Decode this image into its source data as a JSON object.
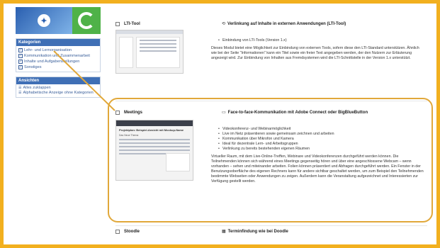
{
  "sidebar": {
    "kategorien": {
      "heading": "Kategorien",
      "items": [
        "Lehr- und Lernorganisation",
        "Kommunikation und Zusammenarbeit",
        "Inhalte und Aufgabenstellungen",
        "Sonstiges"
      ]
    },
    "ansichten": {
      "heading": "Ansichten",
      "items": [
        "Alles zuklappen",
        "Alphabetische Anzeige ohne Kategorien"
      ]
    }
  },
  "entries": [
    {
      "title": "LTI-Tool",
      "category": "Verlinkung auf Inhalte in externen Anwendungen (LTI-Tool)",
      "bullets": [
        "Einbindung von LTI-Tools (Version 1.x)"
      ],
      "paragraph": "Dieses Modul bietet eine Möglichkeit zur Einbindung von externen Tools, sofern diese den LTI-Standard unterstützen. Ähnlich wie bei der Seite \"Informationen\" kann ein Titel sowie ein freier Text angegeben werden, der den Nutzern zur Erläuterung angezeigt wird. Zur Einbindung von Inhalten aus Fremdsystemen wird die LTI-Schnittstelle in der Version 1.x unterstützt."
    },
    {
      "title": "Meetings",
      "category": "Face-to-face-Kommunikation mit Adobe Connect oder BigBlueButton",
      "bullets": [
        "Videokonferenz- und Webinarmöglichkeit",
        "Live im Netz präsentieren sowie gemeinsam zeichnen und arbeiten",
        "Kommunikation über Mikrofon und Kamera",
        "Ideal für dezentrale Lern- und Arbeitsgruppen",
        "Verlinkung zu bereits bestehenden eigenen Räumen"
      ],
      "paragraph": "Virtueller Raum, mit dem Live-Online-Treffen, Webinare und Videokonferenzen durchgeführt werden können. Die Teilnehmenden können sich während eines Meetings gegenseitig hören und über eine angeschlossene Webcam – wenn vorhanden – sehen und miteinander arbeiten. Folien können präsentiert und Abfragen durchgeführt werden. Ein Fenster in der Benutzungsoberfläche des eigenen Rechners kann für andere sichtbar geschaltet werden, um zum Beispiel den Teilnehmenden bestimmte Webseiten oder Anwendungen zu zeigen. Außerdem kann die Veranstaltung aufgezeichnet und Interessierten zur Verfügung gestellt werden.",
      "thumb_title": "Projektplan: Beispiel-Ansicht mit Mockup-Name",
      "thumb_section": "Das Neue Thema"
    },
    {
      "title": "Stoodle",
      "category": "Terminfindung wie bei Doodle"
    }
  ],
  "colors": {
    "frame": "#f2b01e",
    "highlight": "#e1a83a",
    "sidebar_head": "#3f6fb5",
    "link": "#3a5f9a"
  }
}
